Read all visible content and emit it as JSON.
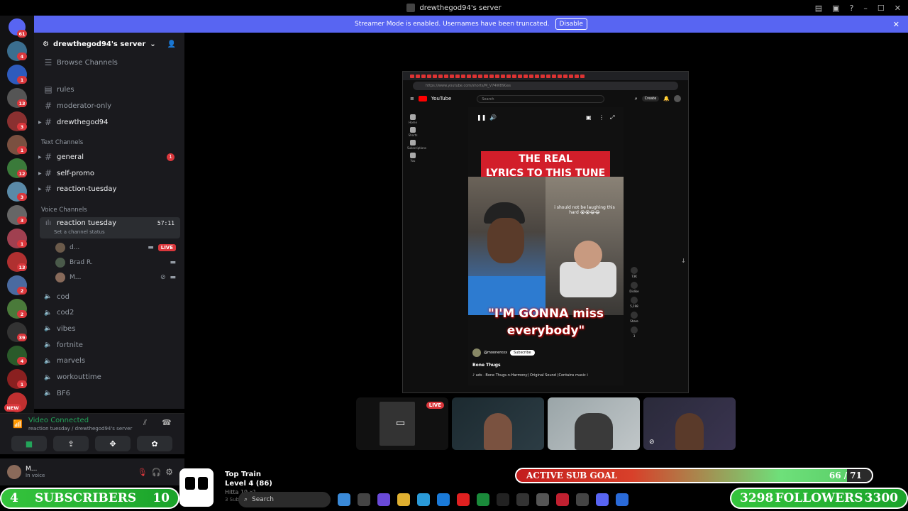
{
  "window": {
    "title": "drewthegod94's server"
  },
  "banner": {
    "text": "Streamer Mode is enabled. Usernames have been truncated.",
    "disable_label": "Disable"
  },
  "guilds": {
    "home_badge": "61",
    "items": [
      {
        "badge": "4",
        "color": "#3b6e8f"
      },
      {
        "badge": "1",
        "color": "#2e5bbd"
      },
      {
        "badge": "13",
        "color": "#555555"
      },
      {
        "badge": "3",
        "color": "#8a3030"
      },
      {
        "badge": "1",
        "color": "#7a5040"
      },
      {
        "badge": "12",
        "color": "#3a7a3a"
      },
      {
        "badge": "3",
        "color": "#5a8aa8"
      },
      {
        "badge": "3",
        "color": "#666666"
      },
      {
        "badge": "1",
        "color": "#a04050"
      },
      {
        "badge": "13",
        "color": "#b03030"
      },
      {
        "badge": "2",
        "color": "#4a6aa0"
      },
      {
        "badge": "2",
        "color": "#4a7a3a"
      },
      {
        "badge": "39",
        "color": "#333333"
      },
      {
        "badge": "4",
        "color": "#2a5a2a"
      },
      {
        "badge": "1",
        "color": "#8a2020"
      },
      {
        "badge": "NEW",
        "color": "#c03030"
      }
    ]
  },
  "server": {
    "name": "drewthegod94's server",
    "browse": "Browse Channels",
    "top_channels": [
      "rules",
      "moderator-only",
      "drewthegod94"
    ],
    "text_category": "Text Channels",
    "text_channels": [
      {
        "name": "general",
        "badge": "1"
      },
      {
        "name": "self-promo",
        "badge": ""
      },
      {
        "name": "reaction-tuesday",
        "badge": ""
      }
    ],
    "voice_category": "Voice Channels",
    "active_voice": {
      "name": "reaction tuesday",
      "time": "57:11",
      "status": "Set a channel status"
    },
    "voice_users": [
      {
        "name": "d...",
        "live": "LIVE"
      },
      {
        "name": "Brad R.",
        "live": ""
      },
      {
        "name": "M...",
        "live": ""
      }
    ],
    "voice_channels": [
      "cod",
      "cod2",
      "vibes",
      "fortnite",
      "marvels",
      "workouttime",
      "BF6"
    ]
  },
  "voice_connected": {
    "title": "Video Connected",
    "subtitle": "reaction tuesday / drewthegod94's server"
  },
  "user": {
    "name": "M...",
    "status": "In voice"
  },
  "youtube": {
    "url": "https://www.youtube.com/shorts/M_V74W89Gss",
    "brand": "YouTube",
    "search_placeholder": "Search",
    "create": "Create",
    "sidenav": [
      "Home",
      "Shorts",
      "Subscriptions",
      "You"
    ],
    "lyrics_line1": "THE REAL",
    "lyrics_line2": "LYRICS TO THIS TUNE",
    "overlay_caption": "i should not be laughing this hard 😭😭😂😂",
    "quote_line1": "\"I'M GONNA miss",
    "quote_line2": "everybody\"",
    "channel": "@moonerxxx",
    "subscribe": "Subscribe",
    "song": "Bone Thugs",
    "audio": "♪ ads · Bone Thugs-n-Harmony)   Original Sound (Contains music i",
    "actions": [
      {
        "label": "73K"
      },
      {
        "label": "Dislike"
      },
      {
        "label": "5,198"
      },
      {
        "label": "Share"
      },
      {
        "label": "3"
      }
    ]
  },
  "tiles": {
    "live_label": "LIVE"
  },
  "overlay": {
    "subscribers": {
      "current": "4",
      "label": "SUBSCRIBERS",
      "goal": "10"
    },
    "followers": {
      "current": "3298",
      "label": "FOLLOWERS",
      "goal": "3300"
    },
    "sub_goal": {
      "label": "ACTIVE SUB GOAL",
      "progress": "66 / 71",
      "fraction": 0.93
    },
    "train": {
      "title": "Top Train",
      "level": "Level 4 (86)",
      "line3": "Hitta 19 x1",
      "line4": "3 Subs"
    }
  },
  "taskbar": {
    "search": "Search"
  }
}
